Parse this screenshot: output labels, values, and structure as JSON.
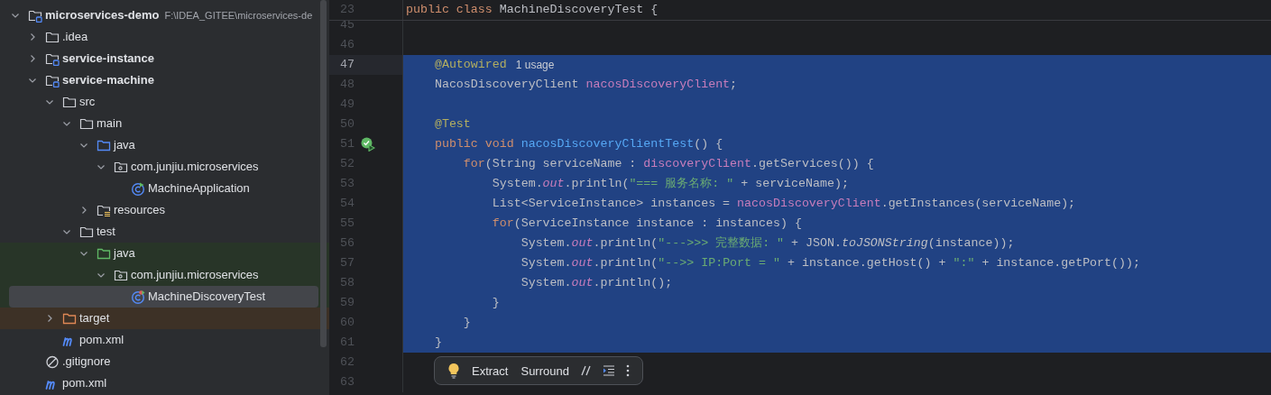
{
  "project_tree": {
    "items": [
      {
        "label": "microservices-demo",
        "path": "F:\\IDEA_GITEE\\microservices-de",
        "kind": "module",
        "expanded": true,
        "selected": false,
        "children": [
          {
            "label": ".idea",
            "kind": "folder",
            "expanded": false,
            "selected": false
          },
          {
            "label": "service-instance",
            "kind": "module",
            "expanded": false,
            "selected": false
          },
          {
            "label": "service-machine",
            "kind": "module",
            "expanded": true,
            "selected": false,
            "children": [
              {
                "label": "src",
                "kind": "folder",
                "expanded": true,
                "selected": false,
                "children": [
                  {
                    "label": "main",
                    "kind": "folder",
                    "expanded": true,
                    "selected": false,
                    "children": [
                      {
                        "label": "java",
                        "kind": "source",
                        "expanded": true,
                        "selected": false,
                        "children": [
                          {
                            "label": "com.junjiu.microservices",
                            "kind": "package",
                            "expanded": true,
                            "selected": false,
                            "children": [
                              {
                                "label": "MachineApplication",
                                "kind": "class",
                                "selected": false
                              }
                            ]
                          }
                        ]
                      },
                      {
                        "label": "resources",
                        "kind": "resources",
                        "expanded": false,
                        "selected": false
                      }
                    ]
                  },
                  {
                    "label": "test",
                    "kind": "folder",
                    "expanded": true,
                    "selected": false,
                    "children": [
                      {
                        "label": "java",
                        "kind": "test-source",
                        "expanded": true,
                        "selected": false,
                        "color": "#283528",
                        "children": [
                          {
                            "label": "com.junjiu.microservices",
                            "kind": "package",
                            "expanded": true,
                            "selected": false,
                            "color": "#283528",
                            "children": [
                              {
                                "label": "MachineDiscoveryTest",
                                "kind": "test-class",
                                "selected": true,
                                "color": "#283528"
                              }
                            ]
                          }
                        ]
                      }
                    ]
                  }
                ]
              },
              {
                "label": "target",
                "kind": "excluded",
                "expanded": false,
                "selected": false,
                "color": "#3d3126"
              },
              {
                "label": "pom.xml",
                "kind": "maven",
                "selected": false
              }
            ]
          },
          {
            "label": ".gitignore",
            "kind": "ignore",
            "selected": false
          },
          {
            "label": "pom.xml",
            "kind": "maven",
            "selected": false
          }
        ]
      }
    ]
  },
  "editor": {
    "sticky_line": {
      "number": "23",
      "tokens": [
        {
          "kind": "keyword",
          "text": "public class "
        },
        {
          "kind": "plain",
          "text": "MachineDiscoveryTest {"
        }
      ]
    },
    "lines": [
      {
        "number": "45",
        "selected": false,
        "current": false
      },
      {
        "number": "46",
        "selected": false,
        "current": false
      },
      {
        "number": "47",
        "selected": true,
        "current": true,
        "tokens": [
          {
            "kind": "annotation",
            "text": "    @Autowired"
          }
        ],
        "hint": "1 usage"
      },
      {
        "number": "48",
        "selected": true,
        "current": false,
        "tokens": [
          {
            "kind": "plain",
            "text": "    NacosDiscoveryClient "
          },
          {
            "kind": "field",
            "text": "nacosDiscoveryClient"
          },
          {
            "kind": "plain",
            "text": ";"
          }
        ]
      },
      {
        "number": "49",
        "selected": true,
        "current": false
      },
      {
        "number": "50",
        "selected": true,
        "current": false,
        "tokens": [
          {
            "kind": "annotation",
            "text": "    @Test"
          }
        ]
      },
      {
        "number": "51",
        "selected": true,
        "current": false,
        "runnable": true,
        "tokens": [
          {
            "kind": "keyword",
            "text": "    public void "
          },
          {
            "kind": "method",
            "text": "nacosDiscoveryClientTest"
          },
          {
            "kind": "plain",
            "text": "() {"
          }
        ]
      },
      {
        "number": "52",
        "selected": true,
        "current": false,
        "tokens": [
          {
            "kind": "keyword",
            "text": "        for"
          },
          {
            "kind": "plain",
            "text": "(String serviceName : "
          },
          {
            "kind": "field",
            "text": "discoveryClient"
          },
          {
            "kind": "plain",
            "text": ".getServices()) {"
          }
        ]
      },
      {
        "number": "53",
        "selected": true,
        "current": false,
        "tokens": [
          {
            "kind": "plain",
            "text": "            System."
          },
          {
            "kind": "static",
            "text": "out"
          },
          {
            "kind": "plain",
            "text": ".println("
          },
          {
            "kind": "string",
            "text": "\"=== 服务名称: \""
          },
          {
            "kind": "plain",
            "text": " + serviceName);"
          }
        ]
      },
      {
        "number": "54",
        "selected": true,
        "current": false,
        "tokens": [
          {
            "kind": "plain",
            "text": "            List<ServiceInstance> instances = "
          },
          {
            "kind": "field",
            "text": "nacosDiscoveryClient"
          },
          {
            "kind": "plain",
            "text": ".getInstances(serviceName);"
          }
        ]
      },
      {
        "number": "55",
        "selected": true,
        "current": false,
        "tokens": [
          {
            "kind": "keyword",
            "text": "            for"
          },
          {
            "kind": "plain",
            "text": "(ServiceInstance instance : instances) {"
          }
        ]
      },
      {
        "number": "56",
        "selected": true,
        "current": false,
        "tokens": [
          {
            "kind": "plain",
            "text": "                System."
          },
          {
            "kind": "static",
            "text": "out"
          },
          {
            "kind": "plain",
            "text": ".println("
          },
          {
            "kind": "string",
            "text": "\"--->>> 完整数据: \""
          },
          {
            "kind": "plain",
            "text": " + JSON."
          },
          {
            "kind": "static-method",
            "text": "toJSONString"
          },
          {
            "kind": "plain",
            "text": "(instance));"
          }
        ]
      },
      {
        "number": "57",
        "selected": true,
        "current": false,
        "tokens": [
          {
            "kind": "plain",
            "text": "                System."
          },
          {
            "kind": "static",
            "text": "out"
          },
          {
            "kind": "plain",
            "text": ".println("
          },
          {
            "kind": "string",
            "text": "\"-->> IP:Port = \""
          },
          {
            "kind": "plain",
            "text": " + instance.getHost() + "
          },
          {
            "kind": "string",
            "text": "\":\""
          },
          {
            "kind": "plain",
            "text": " + instance.getPort());"
          }
        ]
      },
      {
        "number": "58",
        "selected": true,
        "current": false,
        "tokens": [
          {
            "kind": "plain",
            "text": "                System."
          },
          {
            "kind": "static",
            "text": "out"
          },
          {
            "kind": "plain",
            "text": ".println();"
          }
        ]
      },
      {
        "number": "59",
        "selected": true,
        "current": false,
        "tokens": [
          {
            "kind": "plain",
            "text": "            }"
          }
        ]
      },
      {
        "number": "60",
        "selected": true,
        "current": false,
        "tokens": [
          {
            "kind": "plain",
            "text": "        }"
          }
        ]
      },
      {
        "number": "61",
        "selected": true,
        "current": false,
        "tokens": [
          {
            "kind": "plain",
            "text": "    }"
          }
        ]
      },
      {
        "number": "62",
        "selected": false,
        "current": false
      },
      {
        "number": "63",
        "selected": false,
        "current": false
      }
    ],
    "floating_toolbar": {
      "items": [
        {
          "kind": "bulb"
        },
        {
          "kind": "text",
          "label": "Extract"
        },
        {
          "kind": "text",
          "label": "Surround"
        },
        {
          "kind": "comment"
        },
        {
          "kind": "format"
        },
        {
          "kind": "more"
        }
      ]
    }
  }
}
